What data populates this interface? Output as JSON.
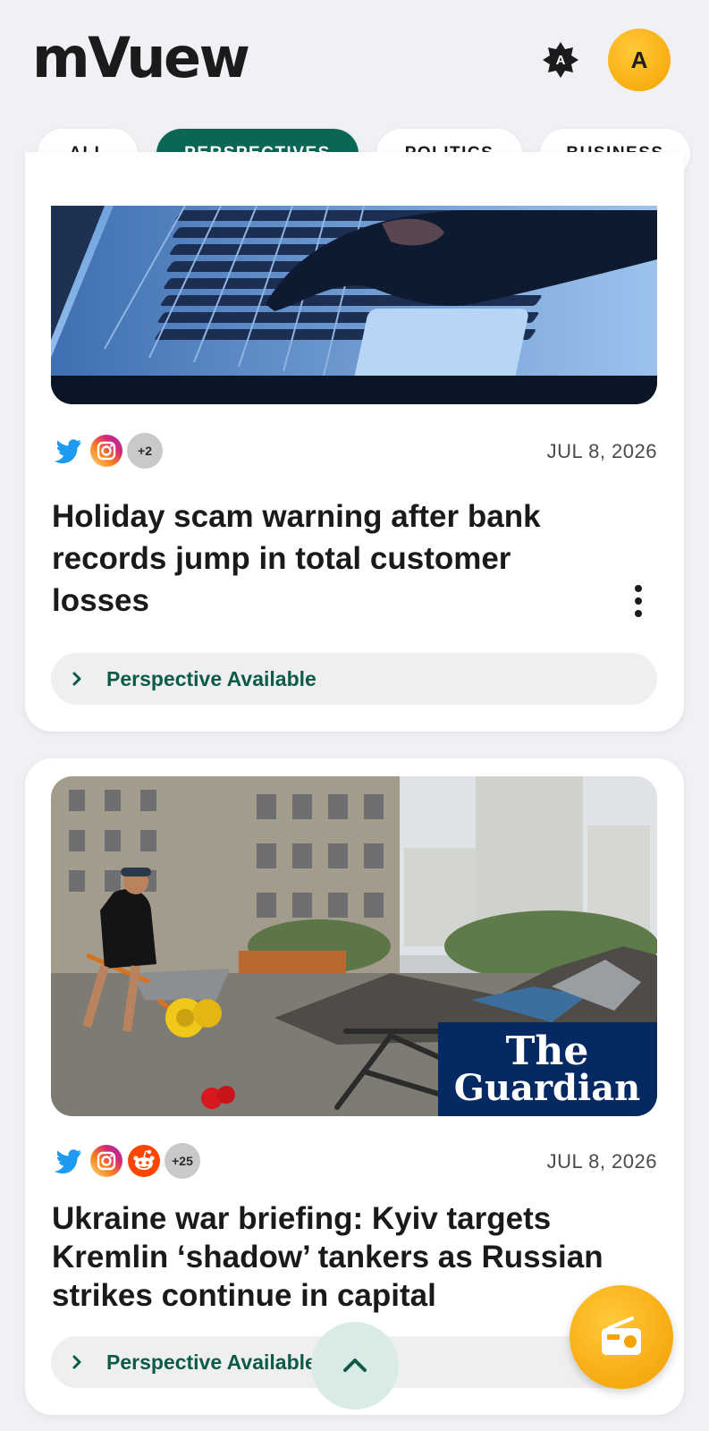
{
  "app": {
    "logo": "mVuew",
    "badge_letter": "A",
    "avatar_letter": "A",
    "accent_color": "#0b6655",
    "fab_color": "#f5a300"
  },
  "tabs": [
    {
      "label": "ALL",
      "active": false
    },
    {
      "label": "PERSPECTIVES",
      "active": true
    },
    {
      "label": "POLITICS",
      "active": false
    },
    {
      "label": "BUSINESS",
      "active": false
    }
  ],
  "articles": [
    {
      "image": "laptop-keyboard-photo",
      "sources": [
        "twitter-icon",
        "instagram-icon"
      ],
      "more_count": "+2",
      "date": "JUL 8, 2026",
      "headline": "Holiday scam warning after bank records jump in total customer losses",
      "perspective_label": "Perspective Available"
    },
    {
      "image": "ukraine-rubble-photo",
      "image_brand": "The\nGuardian",
      "sources": [
        "twitter-icon",
        "instagram-icon",
        "reddit-icon"
      ],
      "more_count": "+25",
      "date": "JUL 8, 2026",
      "headline": "Ukraine war briefing: Kyiv targets Kremlin ‘shadow’ tankers as Russian strikes continue in capital",
      "perspective_label": "Perspective Available"
    }
  ],
  "controls": {
    "scroll_top_icon": "chevron-up-icon",
    "fab_icon": "radio-icon"
  }
}
